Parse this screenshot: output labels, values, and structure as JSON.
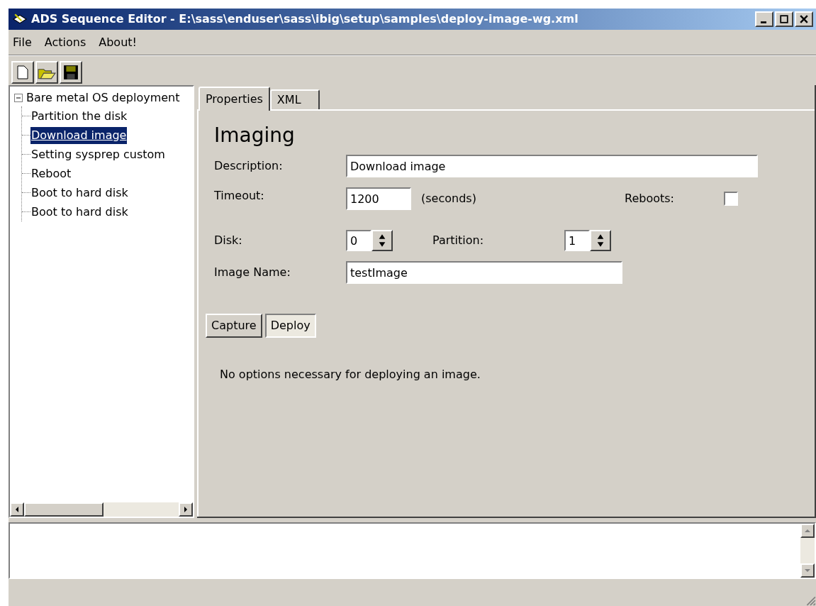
{
  "window": {
    "title": "ADS Sequence Editor - E:\\sass\\enduser\\sass\\ibig\\setup\\samples\\deploy-image-wg.xml"
  },
  "menu": [
    "File",
    "Actions",
    "About!"
  ],
  "tree": {
    "label": "Bare metal OS deployment",
    "expanded": true,
    "selected": false,
    "children": [
      {
        "label": "Partition the disk",
        "selected": false
      },
      {
        "label": "Download image",
        "selected": true
      },
      {
        "label": "Setting sysprep custom",
        "selected": false
      },
      {
        "label": "Reboot",
        "selected": false
      },
      {
        "label": "Boot to hard disk",
        "selected": false
      },
      {
        "label": "Boot to hard disk",
        "selected": false
      }
    ]
  },
  "tabs": [
    {
      "label": "Properties",
      "selected": true
    },
    {
      "label": "XML",
      "selected": false
    }
  ],
  "form": {
    "heading": "Imaging",
    "description": {
      "label": "Description:",
      "value": "Download image"
    },
    "timeout": {
      "label": "Timeout:",
      "value": "1200",
      "unit": "(seconds)"
    },
    "reboots": {
      "label": "Reboots:",
      "checked": false
    },
    "disk": {
      "label": "Disk:",
      "value": "0"
    },
    "partition": {
      "label": "Partition:",
      "value": "1"
    },
    "image_name": {
      "label": "Image Name:",
      "value": "testImage"
    },
    "modes": [
      {
        "label": "Capture",
        "selected": false
      },
      {
        "label": "Deploy",
        "selected": true
      }
    ],
    "message": "No options necessary for deploying an image."
  }
}
